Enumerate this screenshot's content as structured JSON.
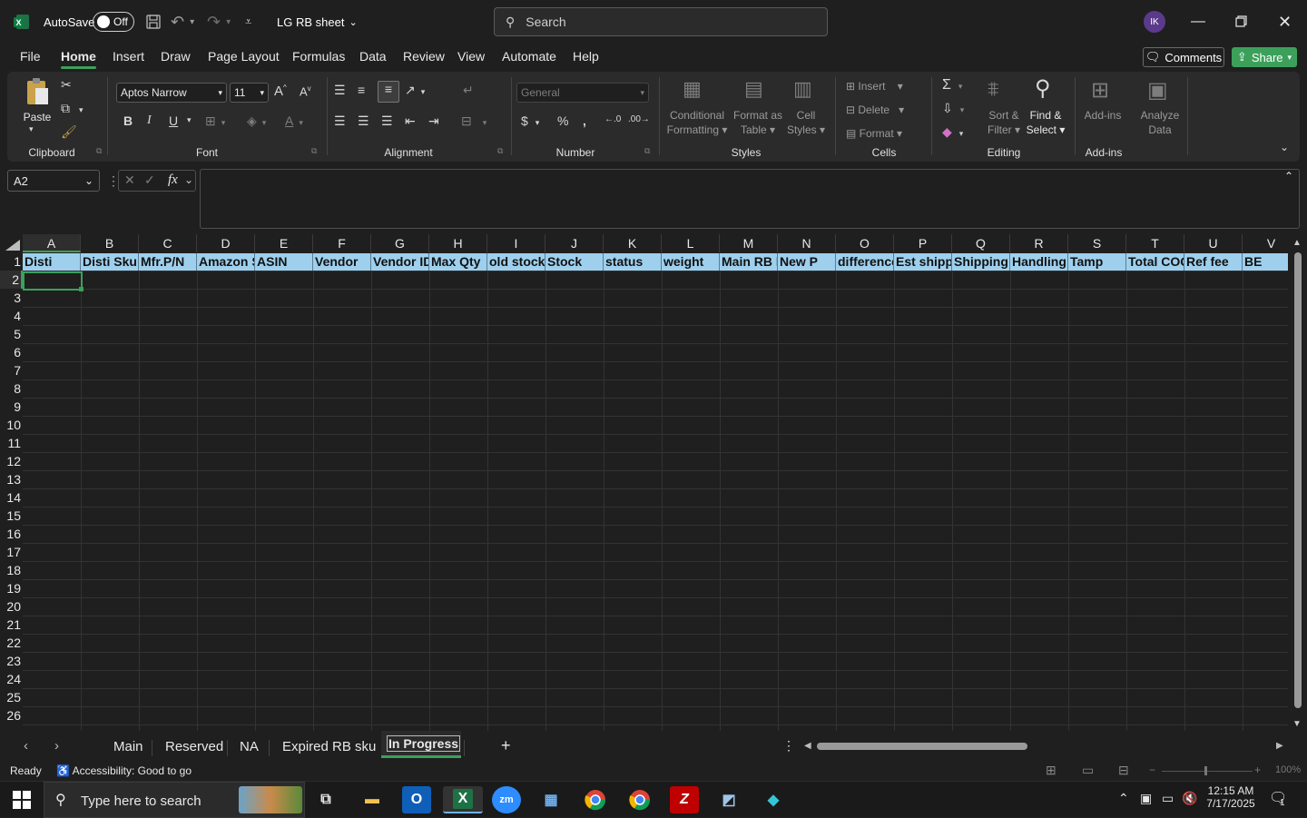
{
  "titlebar": {
    "autosave_label": "AutoSave",
    "autosave_state": "Off",
    "file_name": "LG RB sheet",
    "search_placeholder": "Search",
    "user_initials": "IK"
  },
  "menu": {
    "items": [
      "File",
      "Home",
      "Insert",
      "Draw",
      "Page Layout",
      "Formulas",
      "Data",
      "Review",
      "View",
      "Automate",
      "Help"
    ],
    "active": "Home",
    "comments_label": "Comments",
    "share_label": "Share"
  },
  "ribbon": {
    "clipboard": {
      "paste_label": "Paste",
      "group_label": "Clipboard"
    },
    "font": {
      "font_name": "Aptos Narrow",
      "font_size": "11",
      "bold": "B",
      "italic": "I",
      "underline": "U",
      "group_label": "Font"
    },
    "alignment": {
      "group_label": "Alignment"
    },
    "number": {
      "format": "General",
      "group_label": "Number"
    },
    "styles": {
      "conditional_line1": "Conditional",
      "conditional_line2": "Formatting",
      "format_table_line1": "Format as",
      "format_table_line2": "Table",
      "cell_styles_line1": "Cell",
      "cell_styles_line2": "Styles",
      "group_label": "Styles"
    },
    "cells": {
      "insert": "Insert",
      "delete": "Delete",
      "format": "Format",
      "group_label": "Cells"
    },
    "editing": {
      "sort_line1": "Sort &",
      "sort_line2": "Filter",
      "find_line1": "Find &",
      "find_line2": "Select",
      "group_label": "Editing"
    },
    "addins": {
      "addins_line1": "Add-ins",
      "analyze_line1": "Analyze",
      "analyze_line2": "Data",
      "group_label": "Add-ins"
    }
  },
  "formula_bar": {
    "name_box": "A2",
    "fx_label": "fx",
    "formula": ""
  },
  "sheet": {
    "columns": [
      "A",
      "B",
      "C",
      "D",
      "E",
      "F",
      "G",
      "H",
      "I",
      "J",
      "K",
      "L",
      "M",
      "N",
      "O",
      "P",
      "Q",
      "R",
      "S",
      "T",
      "U",
      "V"
    ],
    "rows": [
      "1",
      "2",
      "3",
      "4",
      "5",
      "6",
      "7",
      "8",
      "9",
      "10",
      "11",
      "12",
      "13",
      "14",
      "15",
      "16",
      "17",
      "18",
      "19",
      "20",
      "21",
      "22",
      "23",
      "24",
      "25",
      "26"
    ],
    "header_row": [
      "Disti",
      "Disti Sku",
      "Mfr.P/N",
      "Amazon S",
      "ASIN",
      "Vendor",
      "Vendor ID",
      "Max Qty",
      "old stock",
      "Stock",
      "status",
      "weight",
      "Main RB P",
      "New P",
      "difference",
      "Est shipp",
      "Shipping",
      "Handling",
      "Tamp",
      "Total COG",
      "Ref fee",
      "BE"
    ],
    "header_fill": "#9ed0ee",
    "selected_cell": "A2"
  },
  "tabs": {
    "items": [
      "Main",
      "Reserved",
      "NA",
      "Expired RB sku",
      "In Progress"
    ],
    "active": "In Progress"
  },
  "status": {
    "ready": "Ready",
    "accessibility": "Accessibility: Good to go",
    "zoom": "100%"
  },
  "taskbar": {
    "search_placeholder": "Type here to search",
    "time": "12:15 AM",
    "date": "7/17/2025",
    "notification_count": "1"
  },
  "colors": {
    "accent": "#3ca05b",
    "share_bg": "#3ca05b",
    "excel_green": "#1e7145",
    "avatar": "#5b3a8c"
  }
}
